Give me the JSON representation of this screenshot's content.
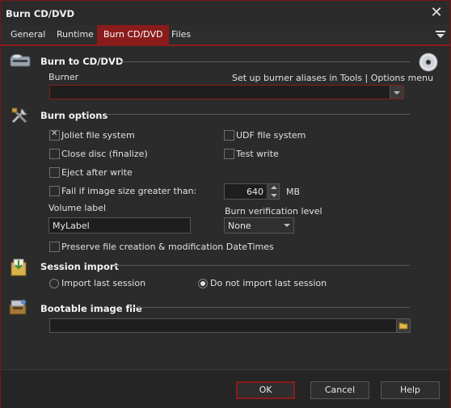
{
  "window": {
    "title": "Burn CD/DVD",
    "close_icon": "close-icon"
  },
  "tabs": [
    {
      "label": "General"
    },
    {
      "label": "Runtime"
    },
    {
      "label": "Burn CD/DVD",
      "active": true
    },
    {
      "label": "Files"
    }
  ],
  "burn_to": {
    "title": "Burn to CD/DVD",
    "burner_label": "Burner",
    "alias_hint": "Set up burner aliases in Tools | Options menu",
    "burner_value": ""
  },
  "burn_options": {
    "title": "Burn options",
    "joliet": {
      "label": "Joliet file system",
      "checked": true
    },
    "udf": {
      "label": "UDF file system",
      "checked": false
    },
    "close_disc": {
      "label": "Close disc (finalize)",
      "checked": false
    },
    "test_write": {
      "label": "Test write",
      "checked": false
    },
    "eject": {
      "label": "Eject after write",
      "checked": false
    },
    "fail_size": {
      "label": "Fail if image size greater than:",
      "checked": false
    },
    "size_value": "640",
    "size_unit": "MB",
    "volume_label": "Volume label",
    "volume_value": "MyLabel",
    "verify_label": "Burn verification level",
    "verify_value": "None",
    "preserve": {
      "label": "Preserve file creation & modification DateTimes",
      "checked": false
    }
  },
  "session": {
    "title": "Session import",
    "import_last": {
      "label": "Import last session",
      "selected": false
    },
    "no_import": {
      "label": "Do not import last session",
      "selected": true
    }
  },
  "bootable": {
    "title": "Bootable image file",
    "path_value": ""
  },
  "footer": {
    "ok": "OK",
    "cancel": "Cancel",
    "help": "Help"
  }
}
